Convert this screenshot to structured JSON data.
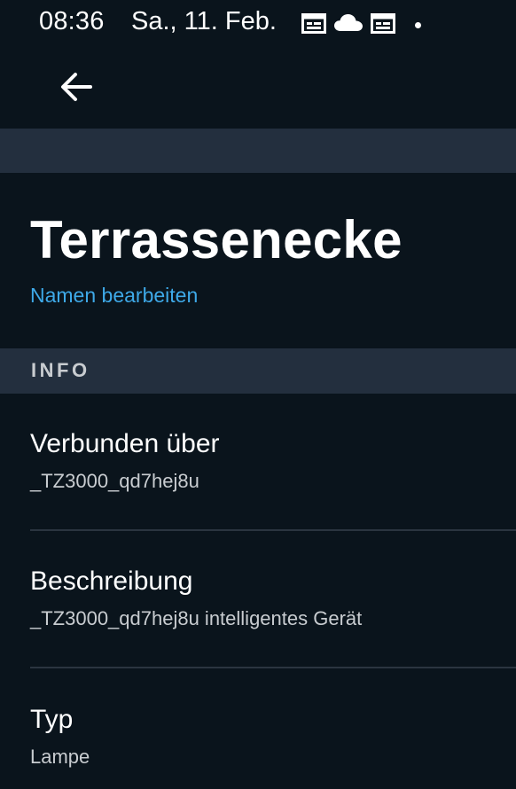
{
  "status_bar": {
    "time": "08:36",
    "date": "Sa., 11. Feb.",
    "icons": [
      "calendar-icon",
      "cloud-icon",
      "calendar-icon",
      "notification-dot"
    ]
  },
  "app_bar": {
    "back_icon": "arrow-left-icon"
  },
  "device": {
    "name": "Terrassenecke",
    "edit_name_label": "Namen bearbeiten"
  },
  "info_section": {
    "header": "INFO",
    "rows": [
      {
        "title": "Verbunden über",
        "value": "_TZ3000_qd7hej8u"
      },
      {
        "title": "Beschreibung",
        "value": "_TZ3000_qd7hej8u intelligentes Gerät"
      },
      {
        "title": "Typ",
        "value": "Lampe"
      }
    ]
  },
  "colors": {
    "background": "#0a141c",
    "band": "#232f3e",
    "link": "#3ea9e8",
    "secondary_text": "#c8ccd0",
    "divider": "#2b3540"
  }
}
